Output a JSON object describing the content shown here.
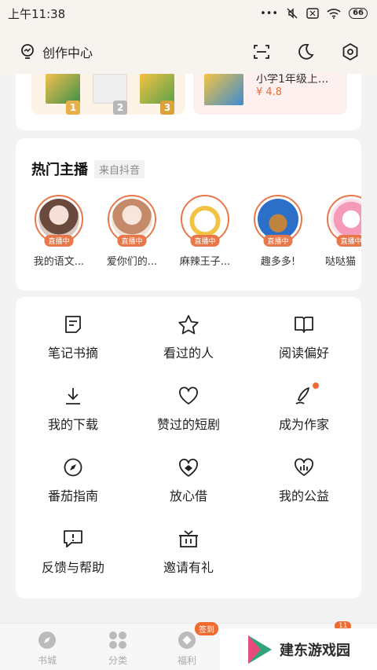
{
  "status_bar": {
    "time": "上午11:38",
    "battery": "66"
  },
  "header": {
    "creator_label": "创作中心"
  },
  "ranking": {
    "ranks": [
      "1",
      "2",
      "3"
    ]
  },
  "book": {
    "title": "小学1年级上...",
    "score": "¥ 4.8"
  },
  "hot_anchors": {
    "title": "热门主播",
    "source": "来自抖音",
    "live_label": "直播中",
    "items": [
      {
        "name": "我的语文..."
      },
      {
        "name": "爱你们的..."
      },
      {
        "name": "麻辣王子..."
      },
      {
        "name": "趣多多!"
      },
      {
        "name": "哒哒猫"
      }
    ]
  },
  "grid": {
    "items": [
      {
        "label": "笔记书摘",
        "icon": "note-icon"
      },
      {
        "label": "看过的人",
        "icon": "star-icon"
      },
      {
        "label": "阅读偏好",
        "icon": "book-icon"
      },
      {
        "label": "我的下载",
        "icon": "download-icon"
      },
      {
        "label": "赞过的短剧",
        "icon": "heart-icon"
      },
      {
        "label": "成为作家",
        "icon": "pen-icon"
      },
      {
        "label": "番茄指南",
        "icon": "compass-icon"
      },
      {
        "label": "放心借",
        "icon": "heart-shield-icon"
      },
      {
        "label": "我的公益",
        "icon": "charity-icon"
      },
      {
        "label": "反馈与帮助",
        "icon": "feedback-icon"
      },
      {
        "label": "邀请有礼",
        "icon": "gift-icon"
      }
    ]
  },
  "bottom_nav": {
    "items": [
      {
        "label": "书城"
      },
      {
        "label": "分类"
      },
      {
        "label": "福利"
      }
    ],
    "sign_badge": "签到",
    "count_badge": "11"
  },
  "watermark": {
    "text": "建东游戏园"
  },
  "colors": {
    "accent": "#e8784a",
    "badge": "#f06b30"
  }
}
